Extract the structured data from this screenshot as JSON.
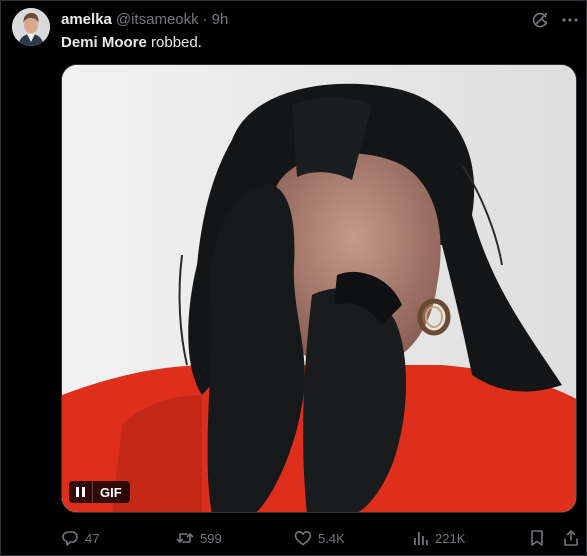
{
  "tweet": {
    "display_name": "amelka",
    "handle": "@itsameokk",
    "separator": "·",
    "time": "9h",
    "text_bold": "Demi Moore",
    "text_rest": " robbed."
  },
  "media": {
    "type": "gif",
    "badge_label": "GIF",
    "description_colors": {
      "background": "#e9e9e9",
      "hair": "#141516",
      "shirt": "#e0321c",
      "skin": "#b8897a"
    }
  },
  "actions": {
    "replies": "47",
    "retweets": "599",
    "likes": "5.4K",
    "views": "221K"
  },
  "icons": {
    "grok": "grok-icon",
    "more": "more-icon",
    "reply": "reply-icon",
    "retweet": "retweet-icon",
    "like": "heart-icon",
    "views": "views-icon",
    "bookmark": "bookmark-icon",
    "share": "share-icon",
    "pause": "pause-icon"
  },
  "colors": {
    "background": "#000000",
    "text_primary": "#e7e9ea",
    "text_secondary": "#71767b",
    "border": "#2f3336"
  }
}
